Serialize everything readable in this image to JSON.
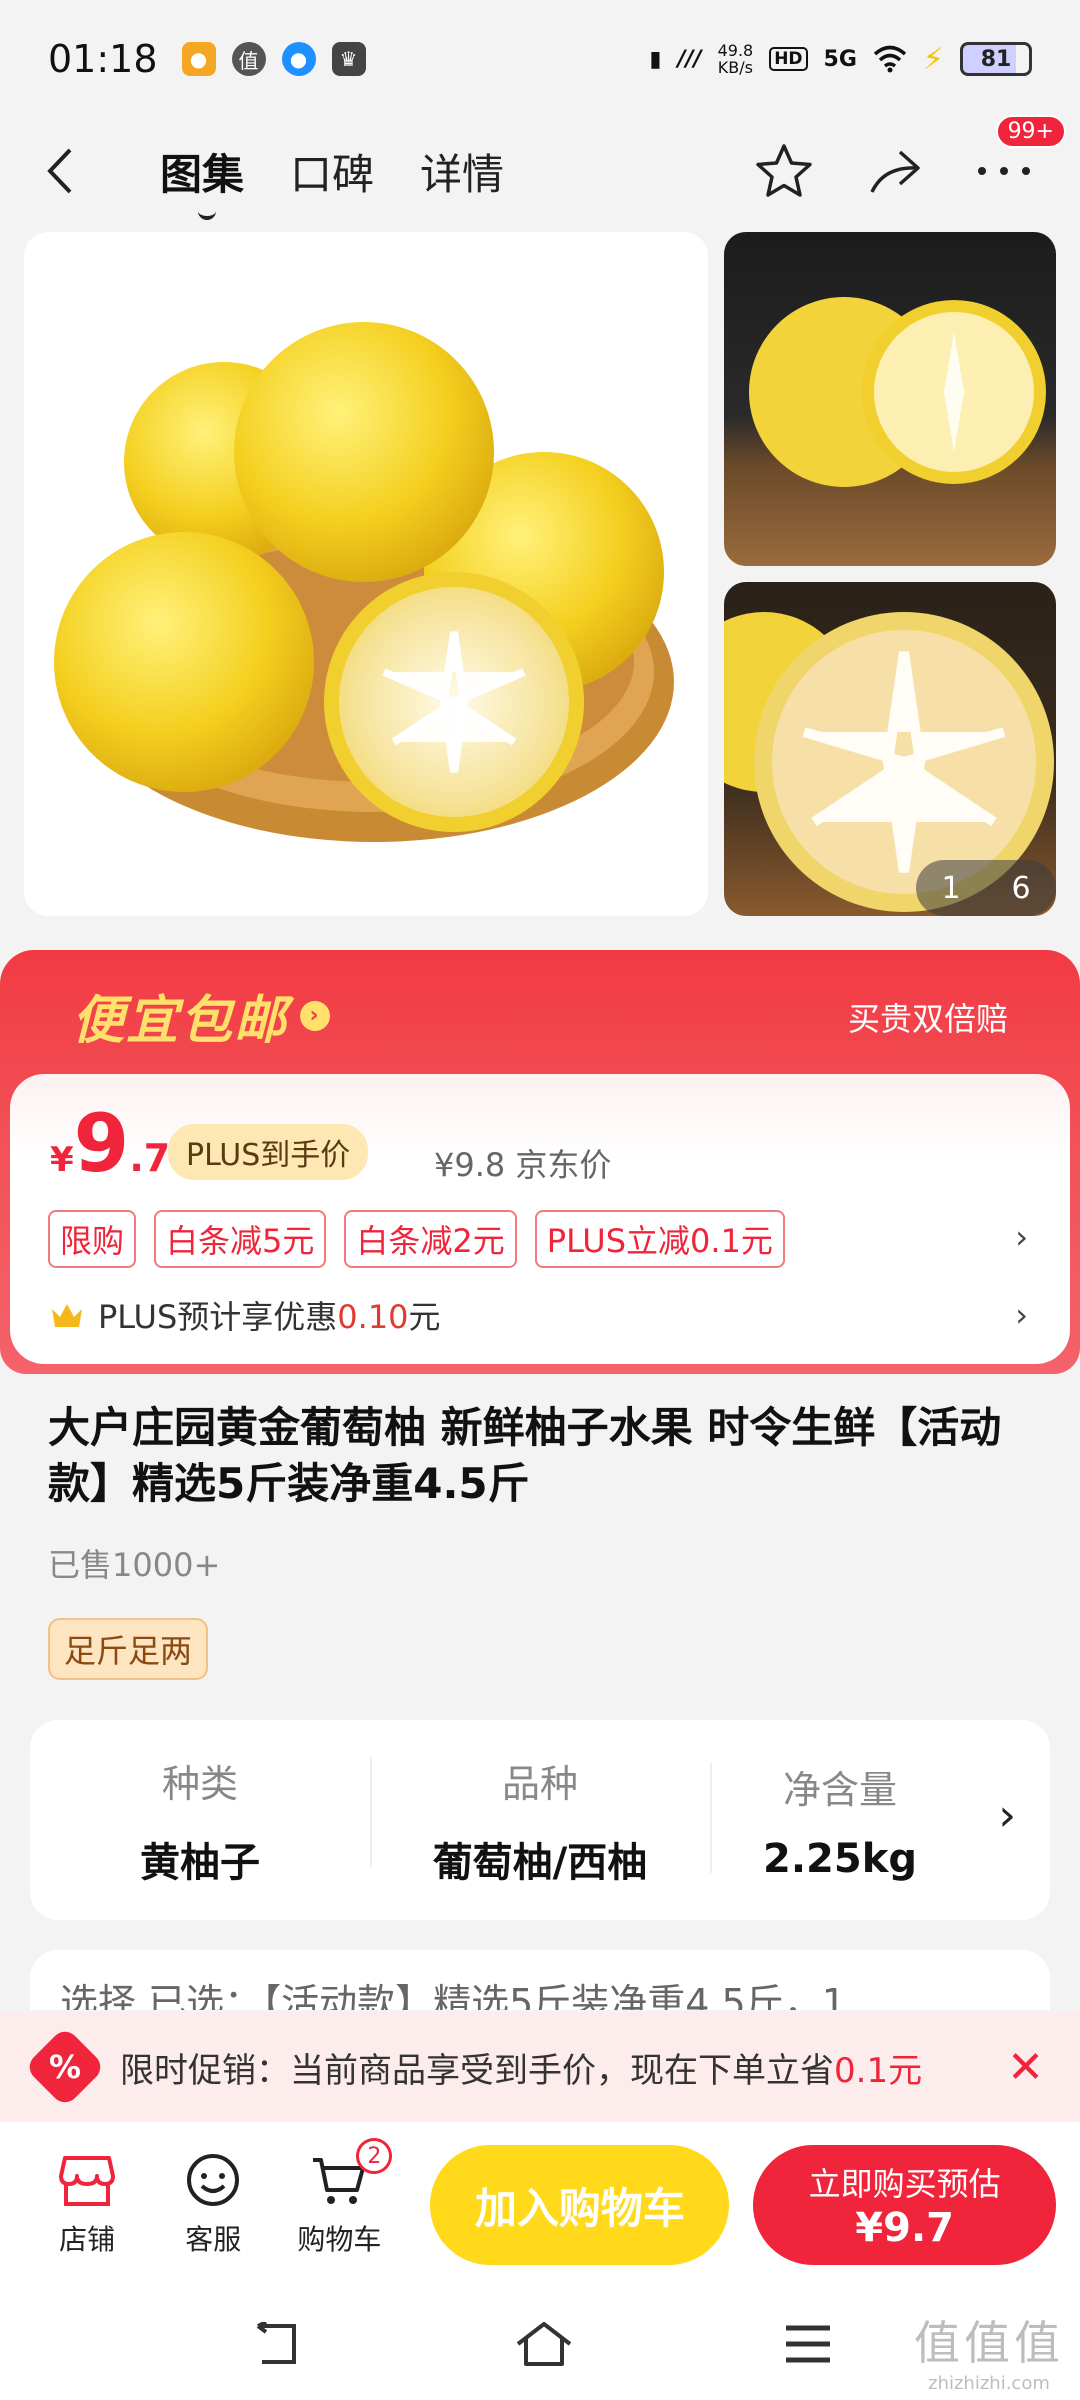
{
  "status": {
    "time": "01:18",
    "net_speed_value": "49.8",
    "net_speed_unit": "KB/s",
    "hd": "HD",
    "signal": "5G",
    "battery": "81"
  },
  "nav": {
    "tabs": [
      {
        "label": "图集"
      },
      {
        "label": "口碑"
      },
      {
        "label": "详情"
      }
    ],
    "message_badge": "99+"
  },
  "gallery": {
    "current": "1",
    "total": "6"
  },
  "promo": {
    "title": "便宜包邮",
    "guarantee": "买贵双倍赔",
    "yen": "¥",
    "price_int": "9",
    "price_dec": ".7",
    "plus_tag": "PLUS到手价",
    "jd_price": "¥9.8 京东价",
    "tags": [
      "限购",
      "白条减5元",
      "白条减2元",
      "PLUS立减0.1元"
    ],
    "plus_prefix": "PLUS预计享优惠",
    "plus_amount": "0.10",
    "plus_suffix": "元"
  },
  "product": {
    "title": "大户庄园黄金葡萄柚 新鲜柚子水果 时令生鲜【活动款】精选5斤装净重4.5斤",
    "sold": "已售1000+",
    "tag": "足斤足两"
  },
  "specs": [
    {
      "label": "种类",
      "value": "黄柚子"
    },
    {
      "label": "品种",
      "value": "葡萄柚/西柚"
    },
    {
      "label": "净含量",
      "value": "2.25kg"
    }
  ],
  "select_row": "选择    已选：【活动款】精选5斤装净重4.5斤，1",
  "limit_promo": {
    "text": "限时促销：当前商品享受到手价，现在下单立省",
    "amount": "0.1元"
  },
  "bottom": {
    "shop": "店铺",
    "service": "客服",
    "cart": "购物车",
    "cart_count": "2",
    "add_cart": "加入购物车",
    "buy_now": "立即购买预估",
    "buy_price": "¥9.7"
  },
  "watermark": {
    "line1": "值值值",
    "line2": "zhizhizhi.com"
  },
  "colors": {
    "accent_red": "#f0243a",
    "promo_yellow": "#ffe06a",
    "add_cart_yellow": "#ffd91a"
  }
}
